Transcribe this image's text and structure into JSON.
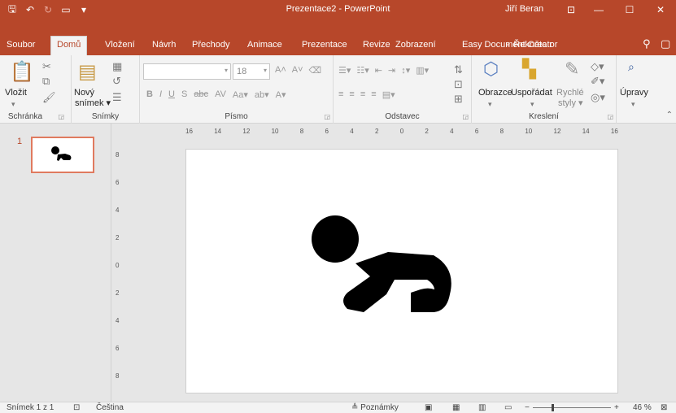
{
  "window": {
    "title": "Prezentace2 - PowerPoint",
    "user": "Jiří Beran"
  },
  "tabs": [
    "Soubor",
    "Domů",
    "Vložení",
    "Návrh",
    "Přechody",
    "Animace",
    "Prezentace",
    "Revize",
    "Zobrazení",
    "Easy Document Creator"
  ],
  "tell_me": "Řekněte r",
  "ribbon": {
    "paste_label": "Vložit",
    "new_slide_label": "Nový",
    "new_slide_label2": "snímek",
    "font_size": "18",
    "shapes_label": "Obrazce",
    "arrange_label": "Uspořádat",
    "quick_styles_label": "Rychlé",
    "quick_styles_label2": "styly",
    "editing_label": "Úpravy",
    "groups": {
      "clipboard": "Schránka",
      "slides": "Snímky",
      "font": "Písmo",
      "paragraph": "Odstavec",
      "drawing": "Kreslení"
    }
  },
  "slides_pane": {
    "slide_number": "1"
  },
  "ruler": {
    "horizontal": [
      "16",
      "14",
      "12",
      "10",
      "8",
      "6",
      "4",
      "2",
      "0",
      "2",
      "4",
      "6",
      "8",
      "10",
      "12",
      "14",
      "16"
    ],
    "vertical": [
      "8",
      "6",
      "4",
      "2",
      "0",
      "2",
      "4",
      "6",
      "8"
    ]
  },
  "status": {
    "slide_info": "Snímek 1 z 1",
    "language": "Čeština",
    "notes": "Poznámky",
    "zoom": "46 %"
  },
  "colors": {
    "accent": "#b7472a",
    "ribbon_bg": "#f3f3f3",
    "workspace_bg": "#e6e6e6",
    "thumb_border": "#e07a5f"
  }
}
